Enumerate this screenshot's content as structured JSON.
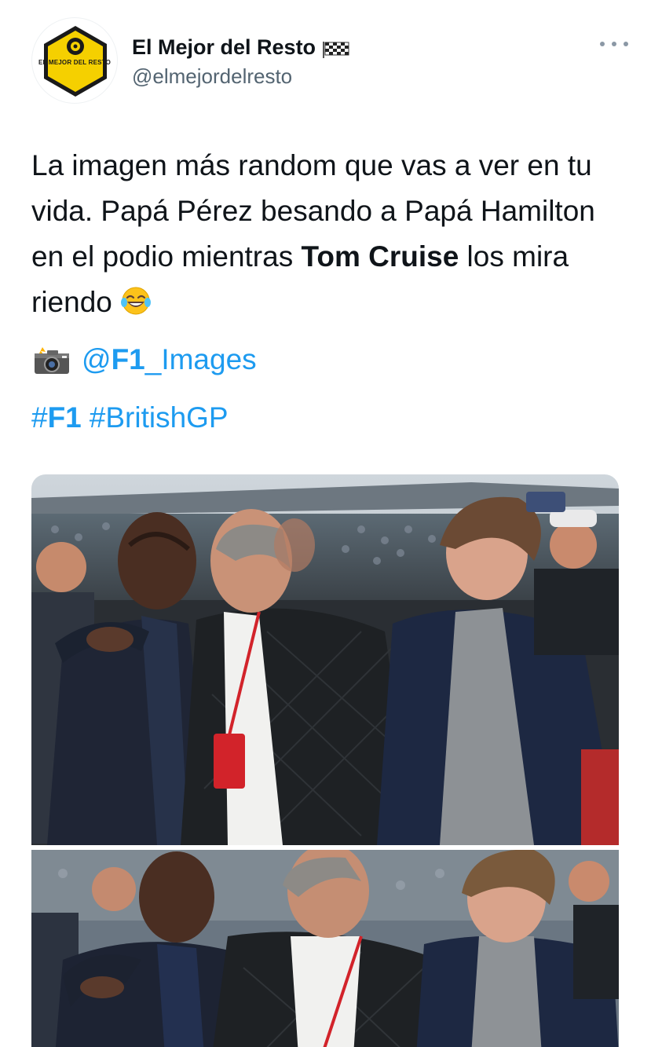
{
  "tweet": {
    "account": {
      "display_name": "El Mejor del Resto",
      "handle": "@elmejordelresto",
      "avatar_text": "EL MEJOR DEL RESTO",
      "verified_flag_icon": "checkered-flag-icon"
    },
    "text": {
      "segment_1": "La imagen más random que vas a ver en tu vida. Papá Pérez besando a Papá Hamilton en el podio mientras ",
      "bold_name": "Tom Cruise",
      "segment_2": " los mira riendo ",
      "emoji_icon": "tears-of-joy-emoji"
    },
    "credit": {
      "icon": "camera-flash-icon",
      "mention_prefix": "@",
      "mention_bold": "F1",
      "mention_rest": "_Images"
    },
    "hashtags": [
      {
        "prefix": "#",
        "bold": "F1",
        "rest": ""
      },
      {
        "prefix": "#",
        "bold": "",
        "rest": "BritishGP"
      }
    ],
    "media": {
      "photo_1_icon": "photo-top",
      "photo_2_icon": "photo-bottom"
    },
    "more_icon": "more-dots-icon"
  },
  "colors": {
    "link": "#1d9bf0",
    "text": "#0f1419",
    "secondary": "#536471",
    "avatar_yellow": "#f5d000"
  }
}
